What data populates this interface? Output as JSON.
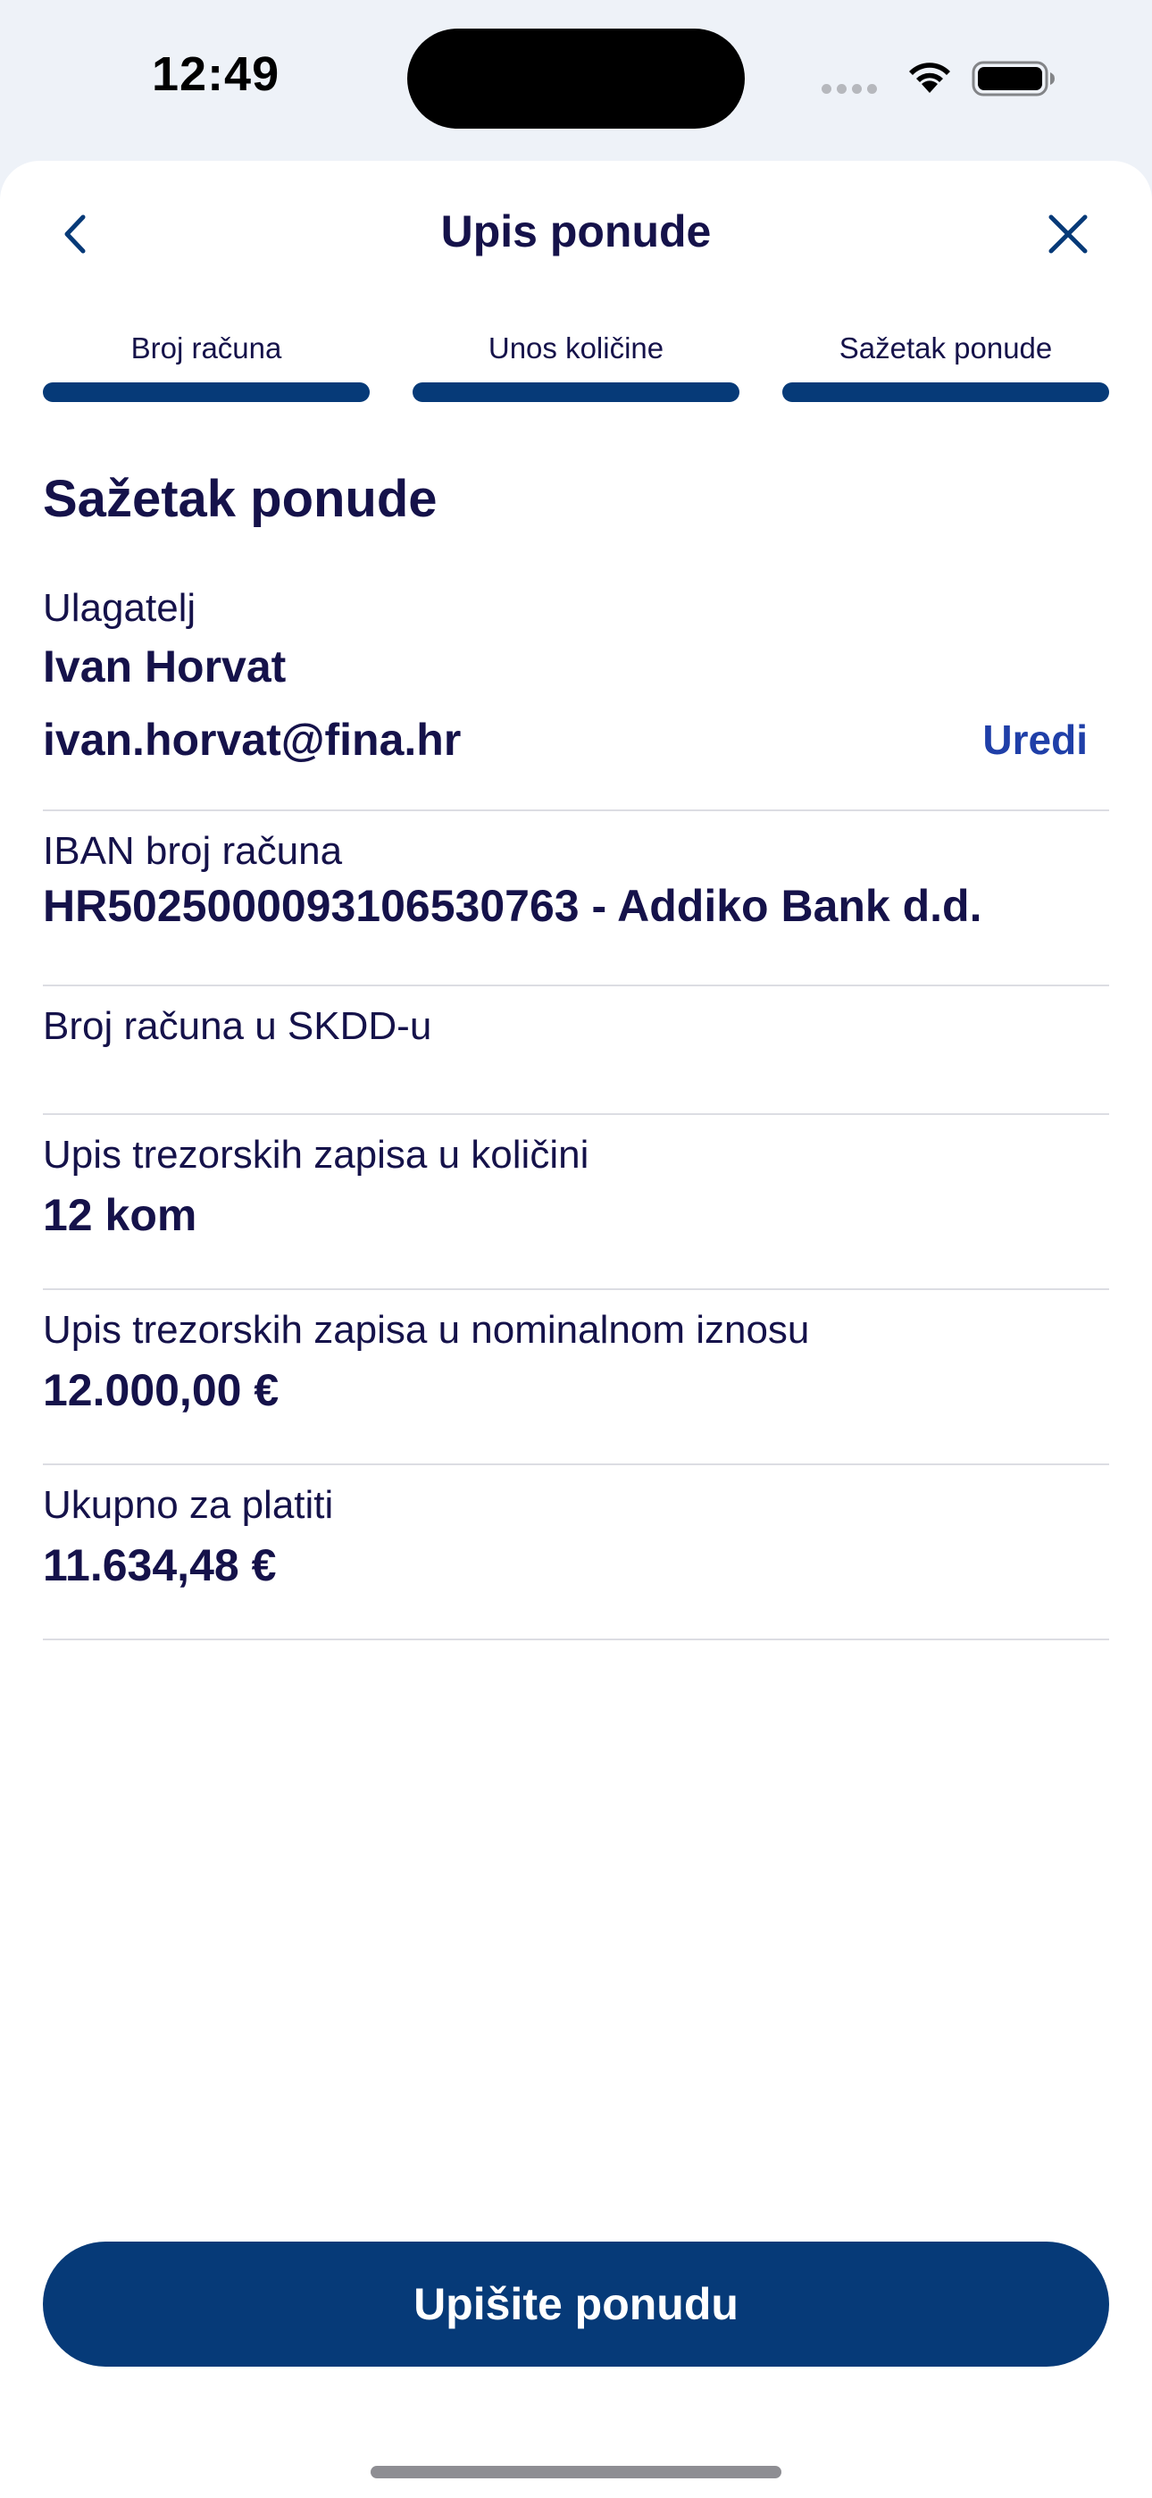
{
  "status_bar": {
    "time": "12:49"
  },
  "header": {
    "title": "Upis ponude",
    "back_icon": "chevron-left-icon",
    "close_icon": "close-icon"
  },
  "stepper": {
    "steps": [
      {
        "label": "Broj računa",
        "completed": true
      },
      {
        "label": "Unos količine",
        "completed": true
      },
      {
        "label": "Sažetak ponude",
        "completed": true
      }
    ],
    "active_color": "#063a78"
  },
  "summary": {
    "title": "Sažetak ponude",
    "investor": {
      "label": "Ulagatelj",
      "name": "Ivan Horvat",
      "email": "ivan.horvat@fina.hr",
      "edit_label": "Uredi"
    },
    "iban": {
      "label": "IBAN broj računa",
      "value": "HR5025000093106530763 - Addiko Bank d.d."
    },
    "skdd": {
      "label": "Broj računa u SKDD-u",
      "value": ""
    },
    "quantity": {
      "label": "Upis trezorskih zapisa u količini",
      "value": "12 kom"
    },
    "nominal": {
      "label": "Upis trezorskih zapisa u nominalnom iznosu",
      "value": "12.000,00 €"
    },
    "total": {
      "label": "Ukupno za platiti",
      "value": "11.634,48 €"
    }
  },
  "actions": {
    "submit_label": "Upišite ponudu"
  },
  "colors": {
    "primary": "#063a78",
    "text": "#15124a",
    "link": "#1f3fa8",
    "background": "#eef2f8"
  }
}
